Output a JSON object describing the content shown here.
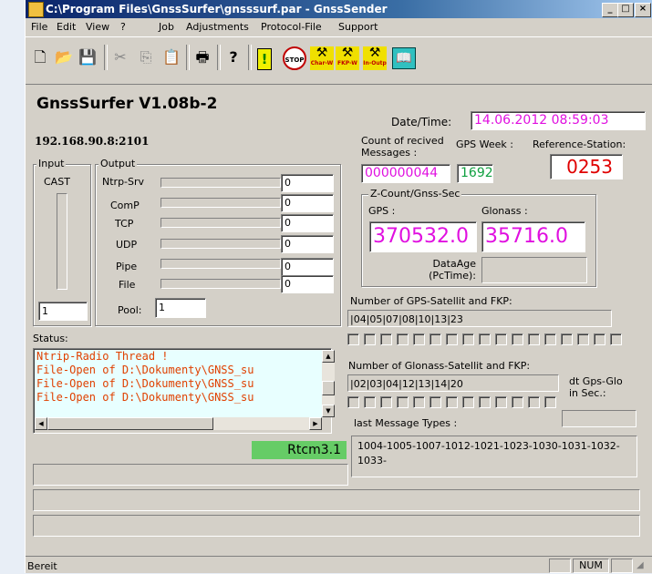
{
  "window": {
    "title": "C:\\Program Files\\GnssSurfer\\gnsssurf.par - GnssSender",
    "min": "_",
    "max": "□",
    "close": "×"
  },
  "menu": [
    "File",
    "Edit",
    "View",
    "?",
    "Job",
    "Adjustments",
    "Protocol-File",
    "Support"
  ],
  "toolbar": {
    "labels": {
      "char": "Char-W",
      "fkp": "FKP-W",
      "inout": "In-Outp",
      "stop": "STOP"
    }
  },
  "app": {
    "heading": "GnssSurfer V1.08b-2",
    "address": "192.168.90.8:2101"
  },
  "input": {
    "label": "Input",
    "type": "CAST",
    "value": "1"
  },
  "output": {
    "label": "Output",
    "rows": [
      {
        "name": "Ntrp-Srv",
        "value": "0"
      },
      {
        "name": "ComP",
        "value": "0"
      },
      {
        "name": "TCP",
        "value": "0"
      },
      {
        "name": "UDP",
        "value": "0"
      },
      {
        "name": "Pipe",
        "value": "0"
      },
      {
        "name": "File",
        "value": "0"
      }
    ],
    "pool_label": "Pool:",
    "pool_value": "1"
  },
  "datetime": {
    "label": "Date/Time:",
    "value": "14.06.2012  08:59:03"
  },
  "counts": {
    "messages_label": "Count of recived Messages :",
    "messages_value": "000000044",
    "gpsweek_label": "GPS Week :",
    "gpsweek_value": "1692",
    "refstation_label": "Reference-Station:",
    "refstation_value": "0253"
  },
  "zcount": {
    "label": "Z-Count/Gnss-Sec",
    "gps_label": "GPS :",
    "gps_value": "370532.0",
    "glonass_label": "Glonass :",
    "glonass_value": "35716.0",
    "dataage_label": "DataAge (PcTime):",
    "dataage_value": ""
  },
  "gps_sat": {
    "label": "Number of GPS-Satellit and FKP:",
    "value": "|04|05|07|08|10|13|23"
  },
  "glo_sat": {
    "label": "Number of Glonass-Satellit and FKP:",
    "value": "|02|03|04|12|13|14|20"
  },
  "dtgpsglo": {
    "label": "dt Gps-Glo in Sec.:",
    "value": ""
  },
  "status": {
    "label": "Status:",
    "lines": [
      "Ntrip-Radio Thread !",
      "File-Open of D:\\Dokumenty\\GNSS_su",
      "File-Open of D:\\Dokumenty\\GNSS_su",
      "File-Open of D:\\Dokumenty\\GNSS_su"
    ]
  },
  "lastmsg": {
    "label": "last Message Types :",
    "value": "1004-1005-1007-1012-1021-1023-1030-1031-1032-1033-"
  },
  "format": {
    "value": "Rtcm3.1"
  },
  "statusbar": {
    "text": "Bereit",
    "num": "NUM"
  },
  "colors": {
    "titlebar": "#0a246a",
    "highlight": "#e010e0",
    "green": "#66cc66",
    "status_text": "#e04000"
  }
}
